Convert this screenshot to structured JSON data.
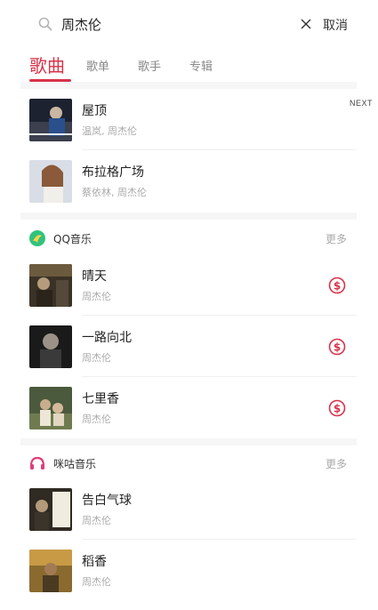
{
  "search": {
    "query": "周杰伦",
    "cancel_label": "取消"
  },
  "tabs": [
    {
      "label": "歌曲",
      "active": true
    },
    {
      "label": "歌单",
      "active": false
    },
    {
      "label": "歌手",
      "active": false
    },
    {
      "label": "专辑",
      "active": false
    }
  ],
  "next_label": "NEXT",
  "results_top": [
    {
      "title": "屋顶",
      "artist": "温岚, 周杰伦"
    },
    {
      "title": "布拉格广场",
      "artist": "蔡依林, 周杰伦"
    }
  ],
  "qq": {
    "name": "QQ音乐",
    "more": "更多",
    "songs": [
      {
        "title": "晴天",
        "artist": "周杰伦"
      },
      {
        "title": "一路向北",
        "artist": "周杰伦"
      },
      {
        "title": "七里香",
        "artist": "周杰伦"
      }
    ]
  },
  "migu": {
    "name": "咪咕音乐",
    "more": "更多",
    "songs": [
      {
        "title": "告白气球",
        "artist": "周杰伦"
      },
      {
        "title": "稻香",
        "artist": "周杰伦"
      }
    ]
  },
  "colors": {
    "accent": "#d8334a",
    "qq_green": "#31c27c",
    "qq_yellow": "#ffd24a",
    "migu_pink": "#e23c7a"
  },
  "icons": {
    "search": "search-icon",
    "clear": "close-icon",
    "pay": "paid-song-icon"
  }
}
